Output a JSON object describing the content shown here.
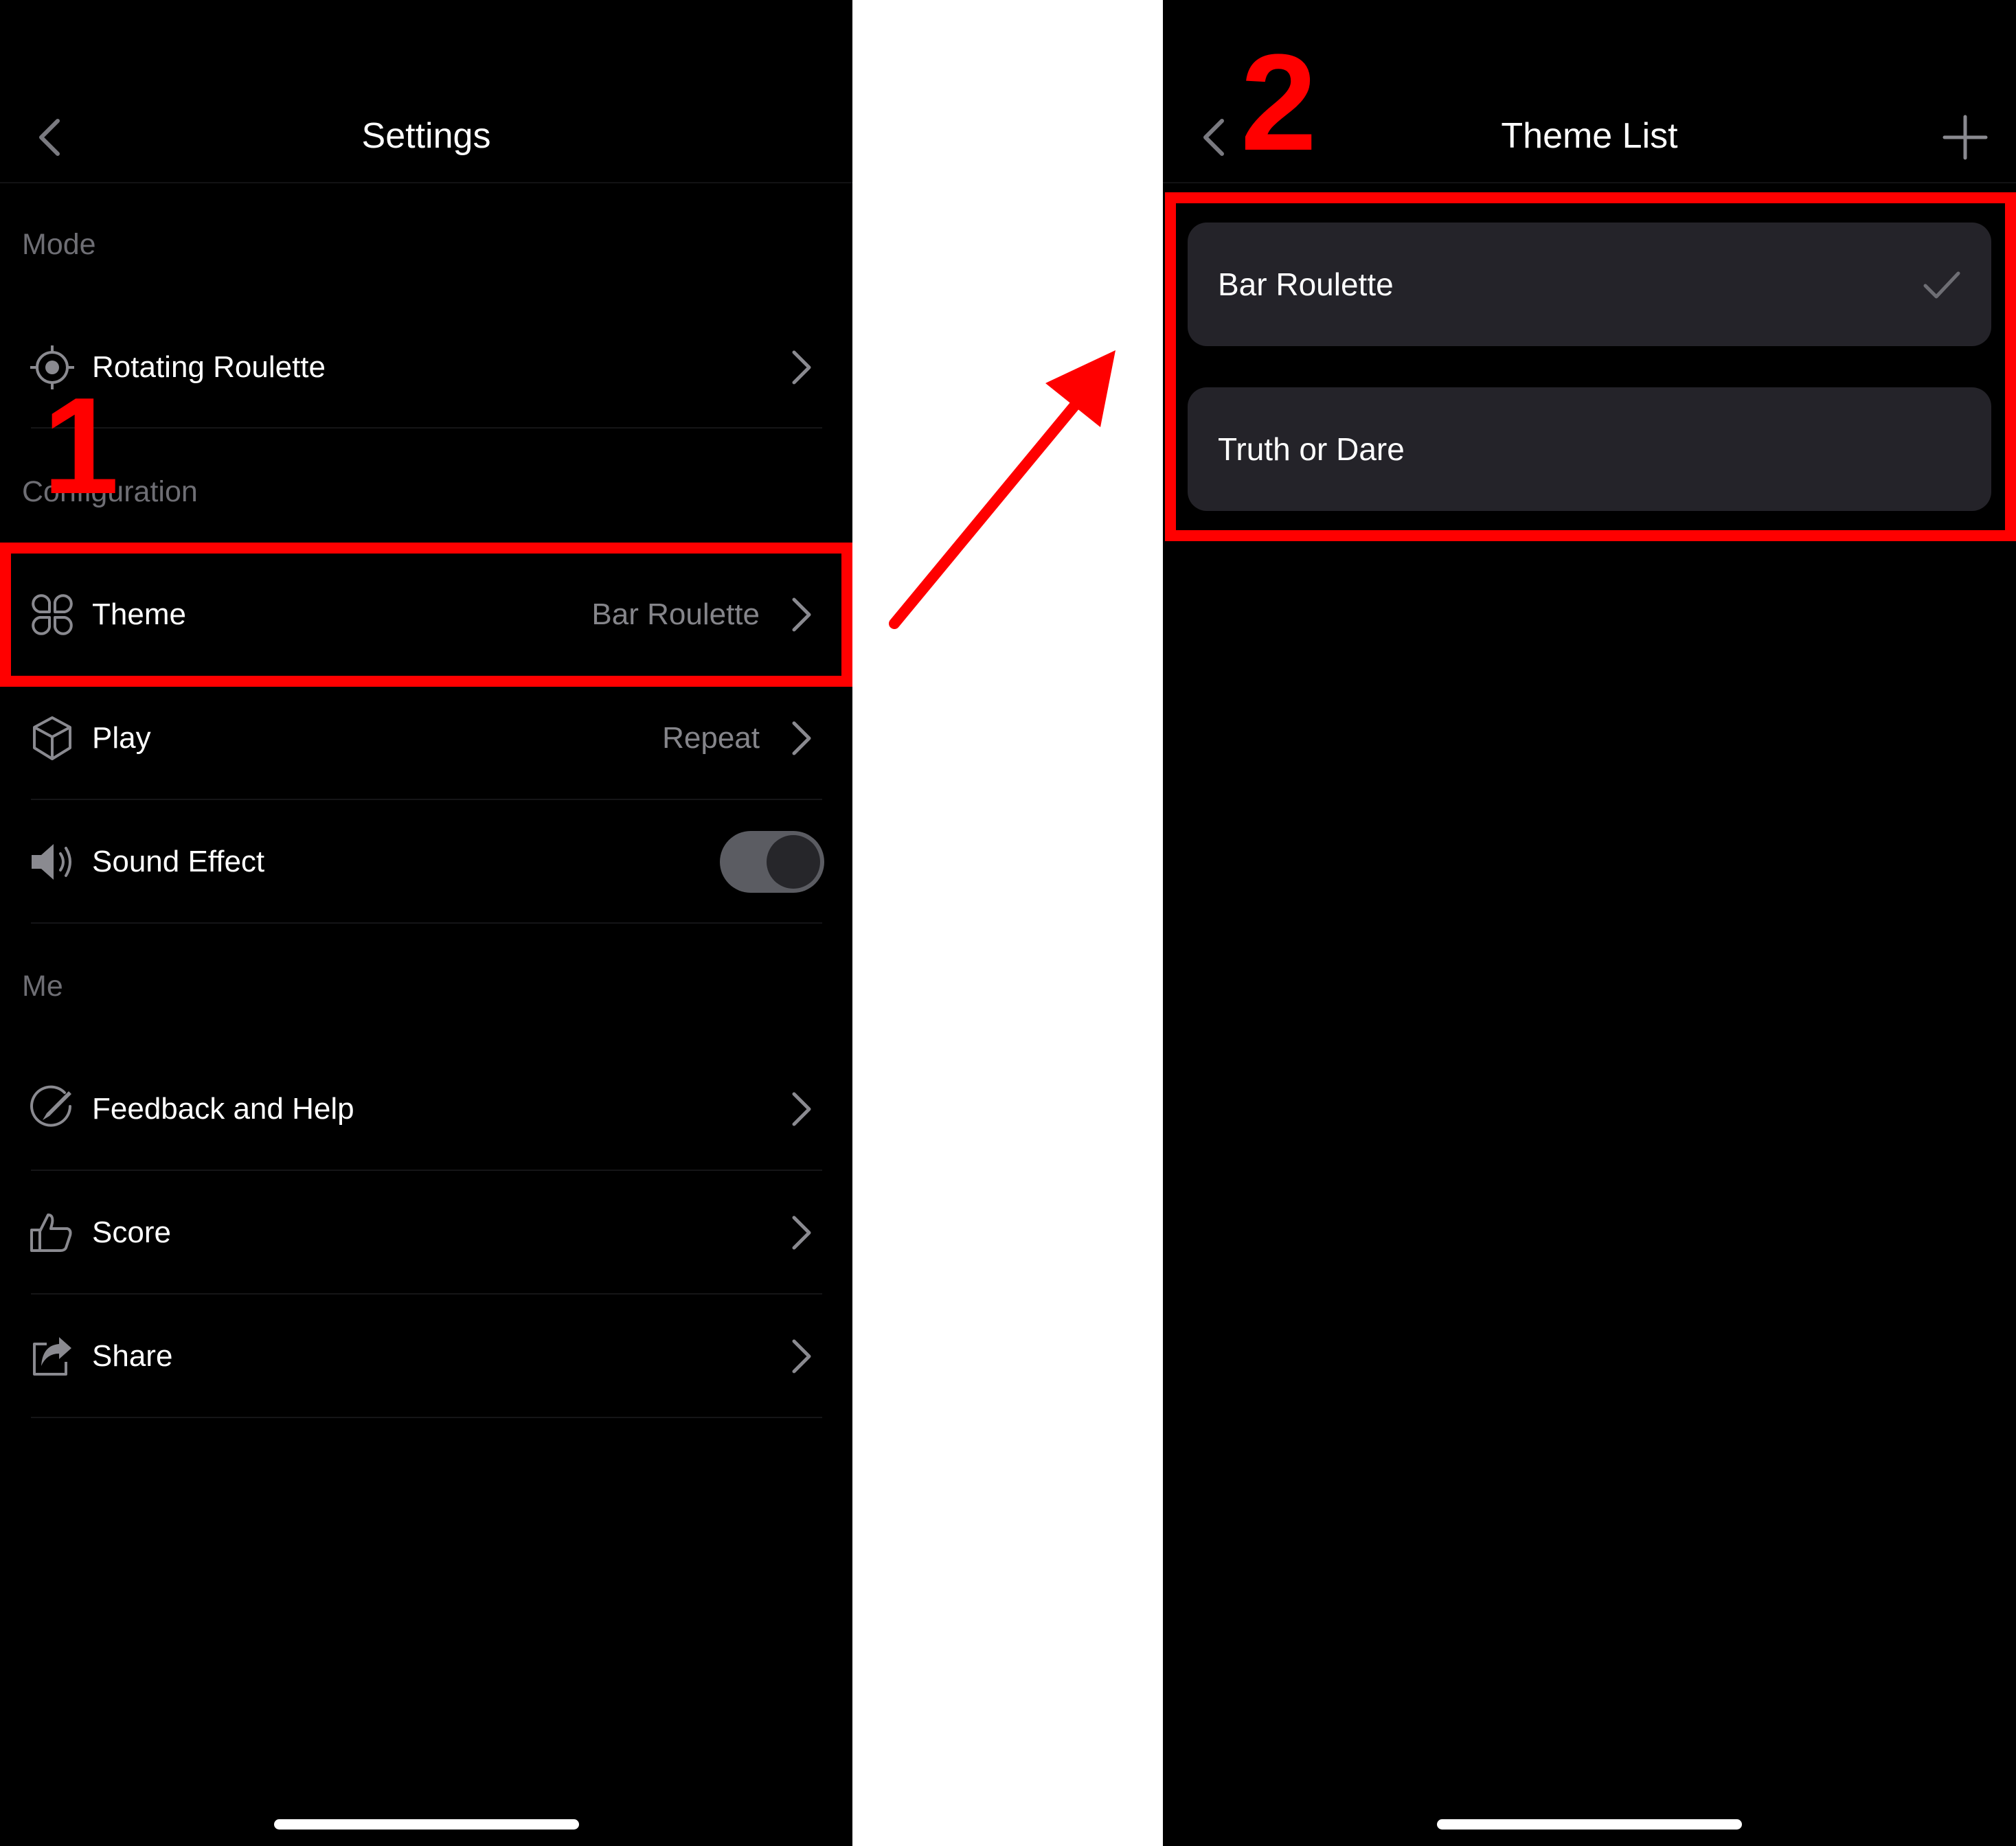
{
  "settings": {
    "title": "Settings",
    "sections": {
      "mode": "Mode",
      "configuration": "Configuration",
      "me": "Me"
    },
    "rows": {
      "rotating_roulette": {
        "label": "Rotating Roulette",
        "icon": "target-icon"
      },
      "theme": {
        "label": "Theme",
        "value": "Bar Roulette",
        "icon": "theme-grid-icon"
      },
      "play": {
        "label": "Play",
        "value": "Repeat",
        "icon": "cube-icon"
      },
      "sound_effect": {
        "label": "Sound Effect",
        "icon": "speaker-icon",
        "toggle_on": false
      },
      "feedback": {
        "label": "Feedback and Help",
        "icon": "feedback-icon"
      },
      "score": {
        "label": "Score",
        "icon": "thumbs-up-icon"
      },
      "share": {
        "label": "Share",
        "icon": "share-icon"
      }
    }
  },
  "theme_list": {
    "title": "Theme List",
    "items": [
      {
        "label": "Bar Roulette",
        "selected": true
      },
      {
        "label": "Truth or Dare",
        "selected": false
      }
    ]
  },
  "annotations": {
    "step1": "1",
    "step2": "2",
    "highlight_color": "#ff0000"
  },
  "colors": {
    "background": "#000000",
    "card": "#242329",
    "secondary_text": "#85858a",
    "section_text": "#6e6e74"
  }
}
